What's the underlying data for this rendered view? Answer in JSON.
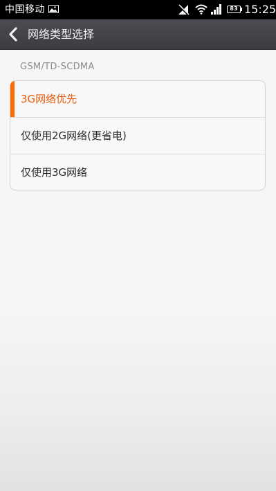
{
  "status_bar": {
    "carrier": "中国移动",
    "battery": "83",
    "time": "15:25",
    "icons": [
      "image-icon",
      "signal-off-icon",
      "wifi-icon",
      "cell-signal-icon",
      "battery-icon"
    ]
  },
  "header": {
    "back_icon": "chevron-left-icon",
    "title": "网络类型选择"
  },
  "section": {
    "label": "GSM/TD-SCDMA"
  },
  "options": [
    {
      "label": "3G网络优先",
      "selected": true
    },
    {
      "label": "仅使用2G网络(更省电)",
      "selected": false
    },
    {
      "label": "仅使用3G网络",
      "selected": false
    }
  ],
  "colors": {
    "accent": "#ff6a00",
    "selected_text": "#ea5a0c",
    "title_bar": "#3b3d42"
  }
}
